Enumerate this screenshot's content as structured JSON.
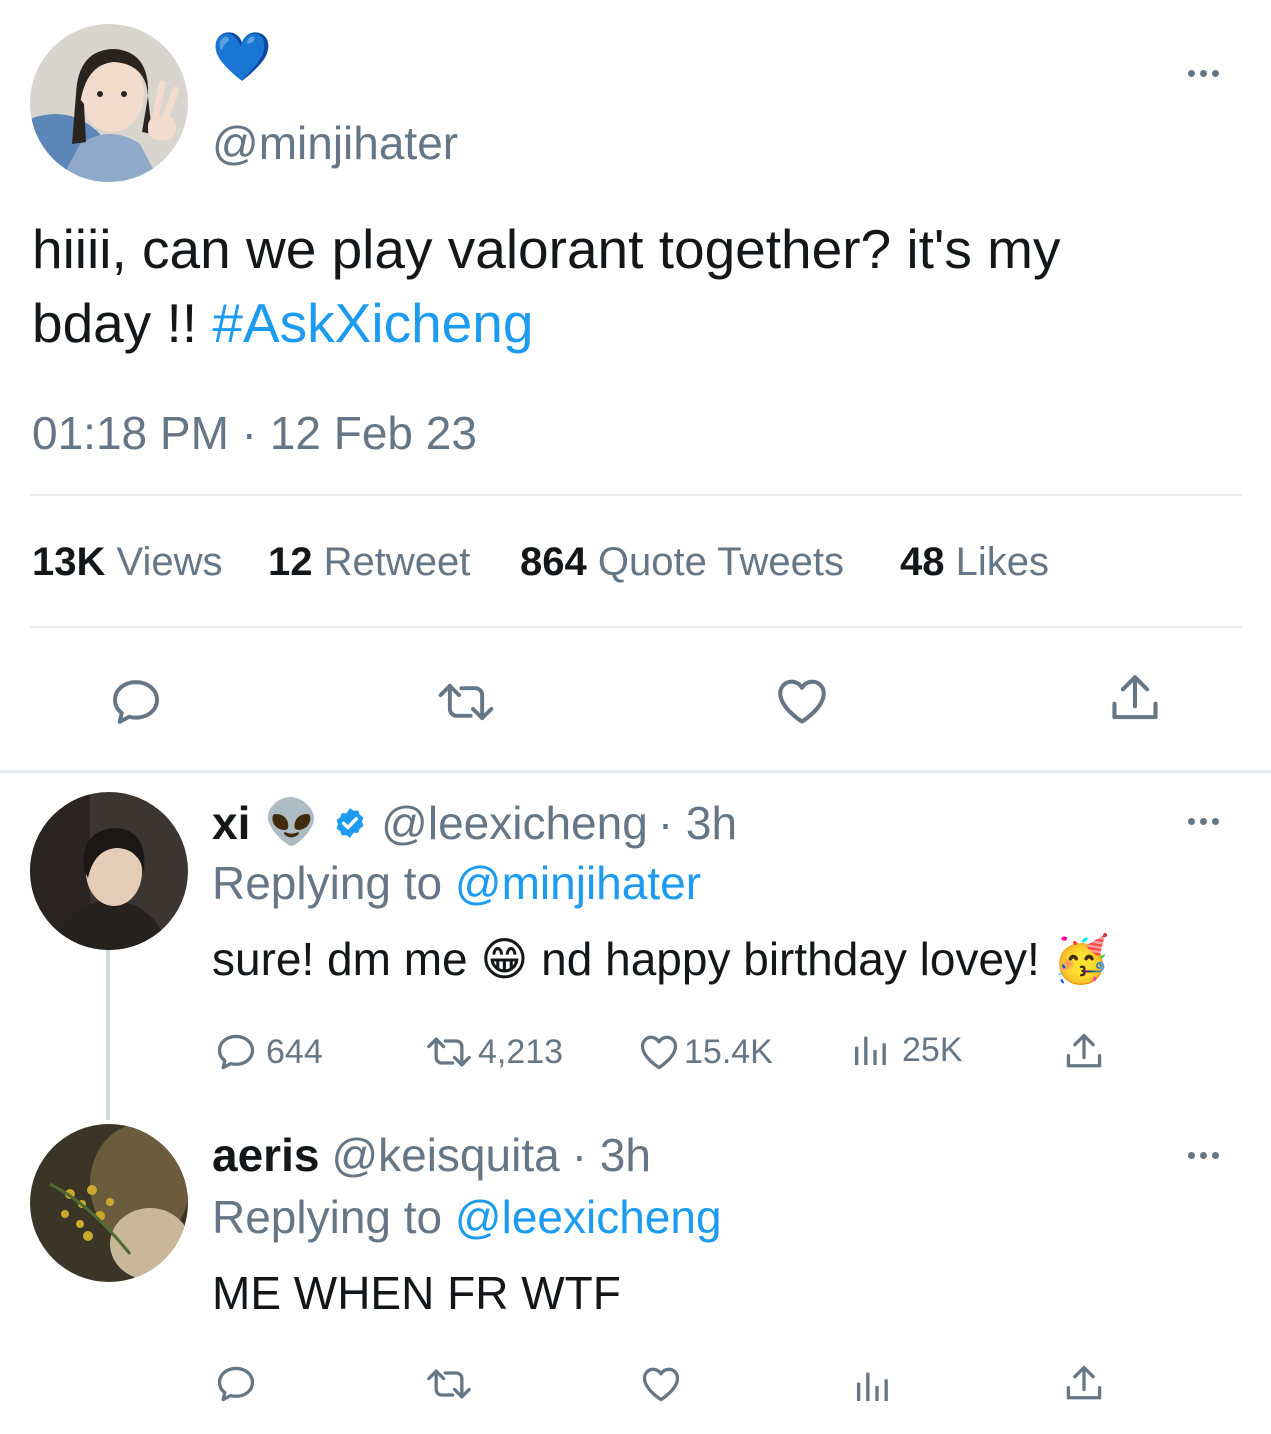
{
  "main_tweet": {
    "display_name_emoji": "💙",
    "handle": "@minjihater",
    "text_line1": "hiiii, can we play valorant together? it's my",
    "text_line2": "bday !!",
    "hashtag": "#AskXicheng",
    "timestamp": "01:18 PM · 12 Feb 23",
    "stats": {
      "views_count": "13K",
      "views_label": "Views",
      "retweets_count": "12",
      "retweets_label": "Retweet",
      "quotes_count": "864",
      "quotes_label": "Quote Tweets",
      "likes_count": "48",
      "likes_label": "Likes"
    }
  },
  "replies": [
    {
      "name": "xi",
      "name_emoji": "👽",
      "handle": "@leexicheng",
      "time": "· 3h",
      "replying_prefix": "Replying to",
      "replying_to": "@minjihater",
      "text_part1": "sure! dm me",
      "emoji1": "😁",
      "text_part2": "nd happy birthday lovey!",
      "emoji2": "🥳",
      "replies_count": "644",
      "retweets_count": "4,213",
      "likes_count": "15.4K",
      "views_count": "25K"
    },
    {
      "name": "aeris",
      "handle": "@keisquita",
      "time": "· 3h",
      "replying_prefix": "Replying to",
      "replying_to": "@leexicheng",
      "text": "ME WHEN FR WTF"
    }
  ],
  "colors": {
    "accent": "#1d9bf0",
    "muted": "#657786",
    "text": "#14171a",
    "divider": "#e6ecf0"
  },
  "icons": [
    "more-icon",
    "reply-icon",
    "retweet-icon",
    "like-icon",
    "share-icon",
    "views-icon",
    "verified-badge-icon"
  ]
}
